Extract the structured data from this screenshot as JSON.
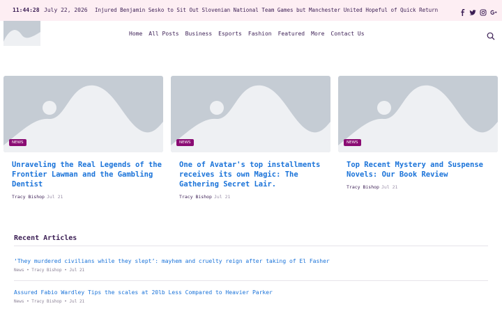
{
  "topbar": {
    "time": "11:44:28",
    "date": "July 22, 2026",
    "ticker": "Injured Benjamin Sesko to Sit Out Slovenian National Team Games but Manchester United Hopeful of Quick Return",
    "social_icons": [
      "facebook-icon",
      "twitter-icon",
      "instagram-icon",
      "google-plus-icon"
    ]
  },
  "nav": {
    "items": [
      "Home",
      "All Posts",
      "Business",
      "Esports",
      "Fashion",
      "Featured",
      "More",
      "Contact Us"
    ]
  },
  "featured": [
    {
      "badge": "NEWS",
      "title": "Unraveling the Real Legends of the Frontier Lawman and the Gambling Dentist",
      "author": "Tracy Bishop",
      "date": "Jul 21"
    },
    {
      "badge": "NEWS",
      "title": "One of Avatar's top installments receives its own Magic: The Gathering Secret Lair.",
      "author": "Tracy Bishop",
      "date": "Jul 21"
    },
    {
      "badge": "NEWS",
      "title": "Top Recent Mystery and Suspense Novels: Our Book Review",
      "author": "Tracy Bishop",
      "date": "Jul 21"
    }
  ],
  "recent": {
    "heading": "Recent Articles",
    "articles": [
      {
        "title": "‘They murdered civilians while they slept’: mayhem and cruelty reign after taking of El Fasher",
        "category": "News",
        "author": "Tracy Bishop",
        "date": "Jul 21"
      },
      {
        "title": "Assured Fabio Wardley Tips the scales at 20lb Less Compared to Heavier Parker",
        "category": "News",
        "author": "Tracy Bishop",
        "date": "Jul 21"
      }
    ]
  },
  "colors": {
    "topbar_bg": "#fdeef3",
    "accent_link": "#1a73d9",
    "badge": "#8a0c73",
    "text": "#3b1e54",
    "placeholder": "#c5ccd4"
  }
}
